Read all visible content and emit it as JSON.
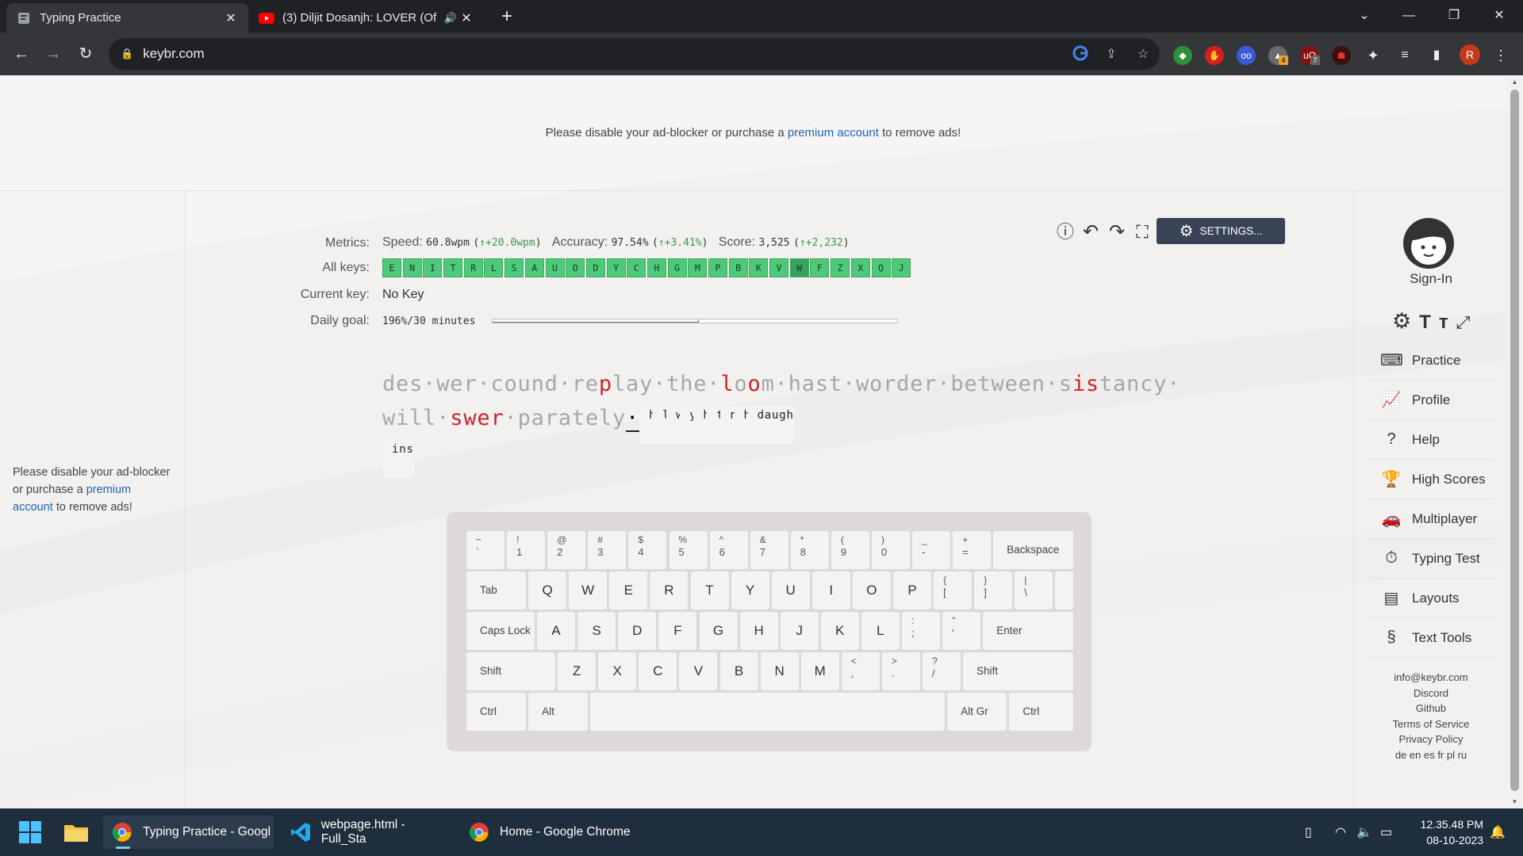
{
  "browser": {
    "tabs": [
      {
        "title": "Typing Practice",
        "active": true
      },
      {
        "title": "(3) Diljit Dosanjh: LOVER (Of",
        "active": false
      }
    ],
    "url": "keybr.com",
    "profile_initial": "R",
    "ext_badges": {
      "a": "4",
      "b": "7"
    }
  },
  "page": {
    "ad_top": {
      "prefix": "Please disable your ad-blocker or purchase a",
      "link": "premium account",
      "suffix": "to remove ads!"
    },
    "ad_left": {
      "prefix": "Please disable your ad-blocker or purchase a",
      "link": "premium account",
      "suffix": "to remove ads!"
    },
    "metrics": {
      "label": "Metrics:",
      "speed_label": "Speed:",
      "speed": "60.8wpm",
      "speed_delta": "↑+20.0wpm",
      "accuracy_label": "Accuracy:",
      "accuracy": "97.54%",
      "accuracy_delta": "↑+3.41%",
      "score_label": "Score:",
      "score": "3,525",
      "score_delta": "↑+2,232",
      "all_keys_label": "All keys:",
      "all_keys": [
        "E",
        "N",
        "I",
        "T",
        "R",
        "L",
        "S",
        "A",
        "U",
        "O",
        "D",
        "Y",
        "C",
        "H",
        "G",
        "M",
        "P",
        "B",
        "K",
        "V",
        "W",
        "F",
        "Z",
        "X",
        "Q",
        "J"
      ],
      "current_key_label": "Current key:",
      "current_key": "No Key",
      "daily_goal_label": "Daily goal:",
      "daily_goal": "196%/30 minutes",
      "daily_goal_progress": 0.51
    },
    "settings_button": "SETTINGS...",
    "text_lines": [
      [
        {
          "t": "des·wer·cound·re",
          "c": "g"
        },
        {
          "t": "p",
          "c": "r"
        },
        {
          "t": "lay·the·",
          "c": "g"
        },
        {
          "t": "l",
          "c": "r"
        },
        {
          "t": "o",
          "c": "g"
        },
        {
          "t": "o",
          "c": "r"
        },
        {
          "t": "m·hast·worder·between·s",
          "c": "g"
        },
        {
          "t": "is",
          "c": "r"
        },
        {
          "t": "tancy·",
          "c": "g"
        }
      ],
      [
        {
          "t": "will·",
          "c": "g"
        },
        {
          "t": "swer",
          "c": "r"
        },
        {
          "t": "·parately",
          "c": "g"
        },
        {
          "t": "·",
          "c": "cur"
        },
        {
          "t": "had",
          "c": "k"
        },
        {
          "t": "·",
          "c": "d"
        },
        {
          "t": "lease",
          "c": "k"
        },
        {
          "t": "·",
          "c": "d"
        },
        {
          "t": "what",
          "c": "k"
        },
        {
          "t": "·",
          "c": "d"
        },
        {
          "t": "you",
          "c": "k"
        },
        {
          "t": "·",
          "c": "d"
        },
        {
          "t": "her",
          "c": "k"
        },
        {
          "t": "·",
          "c": "d"
        },
        {
          "t": "the",
          "c": "k"
        },
        {
          "t": "·",
          "c": "d"
        },
        {
          "t": "new",
          "c": "k"
        },
        {
          "t": "·",
          "c": "d"
        },
        {
          "t": "had",
          "c": "k"
        },
        {
          "t": "·",
          "c": "d"
        },
        {
          "t": "daugh",
          "c": "k"
        },
        {
          "t": "·",
          "c": "d"
        }
      ],
      [
        {
          "t": "ins",
          "c": "k"
        }
      ]
    ],
    "keyboard": {
      "row1": [
        [
          "~",
          "`"
        ],
        [
          "!",
          "1"
        ],
        [
          "@",
          "2"
        ],
        [
          "#",
          "3"
        ],
        [
          "$",
          "4"
        ],
        [
          "%",
          "5"
        ],
        [
          "^",
          "6"
        ],
        [
          "&",
          "7"
        ],
        [
          "*",
          "8"
        ],
        [
          "(",
          "9"
        ],
        [
          ")",
          "0"
        ],
        [
          "_",
          "-"
        ],
        [
          "+",
          "="
        ]
      ],
      "backspace": "Backspace",
      "tab": "Tab",
      "row2": [
        "Q",
        "W",
        "E",
        "R",
        "T",
        "Y",
        "U",
        "I",
        "O",
        "P"
      ],
      "row2_sym": [
        [
          "{",
          "["
        ],
        [
          "}",
          "]"
        ],
        [
          "|",
          "\\"
        ]
      ],
      "caps": "Caps Lock",
      "row3": [
        "A",
        "S",
        "D",
        "F",
        "G",
        "H",
        "J",
        "K",
        "L"
      ],
      "row3_sym": [
        [
          ":",
          ";"
        ],
        [
          "\"",
          "'"
        ]
      ],
      "enter": "Enter",
      "shift": "Shift",
      "row4": [
        "Z",
        "X",
        "C",
        "V",
        "B",
        "N",
        "M"
      ],
      "row4_sym": [
        [
          "<",
          ","
        ],
        [
          ">",
          "."
        ],
        [
          "?",
          "/"
        ]
      ],
      "ctrl": "Ctrl",
      "alt": "Alt",
      "altgr": "Alt Gr"
    },
    "sidebar": {
      "signin": "Sign-In",
      "items": [
        "Practice",
        "Profile",
        "Help",
        "High Scores",
        "Multiplayer",
        "Typing Test",
        "Layouts",
        "Text Tools"
      ],
      "footer": [
        "info@keybr.com",
        "Discord",
        "Github",
        "Terms of Service",
        "Privacy Policy",
        "de en es fr pl ru"
      ]
    }
  },
  "taskbar": {
    "apps": [
      "Typing Practice - Googl",
      "webpage.html - Full_Sta",
      "Home - Google Chrome"
    ],
    "time": "12.35.48 PM",
    "date": "08-10-2023"
  }
}
